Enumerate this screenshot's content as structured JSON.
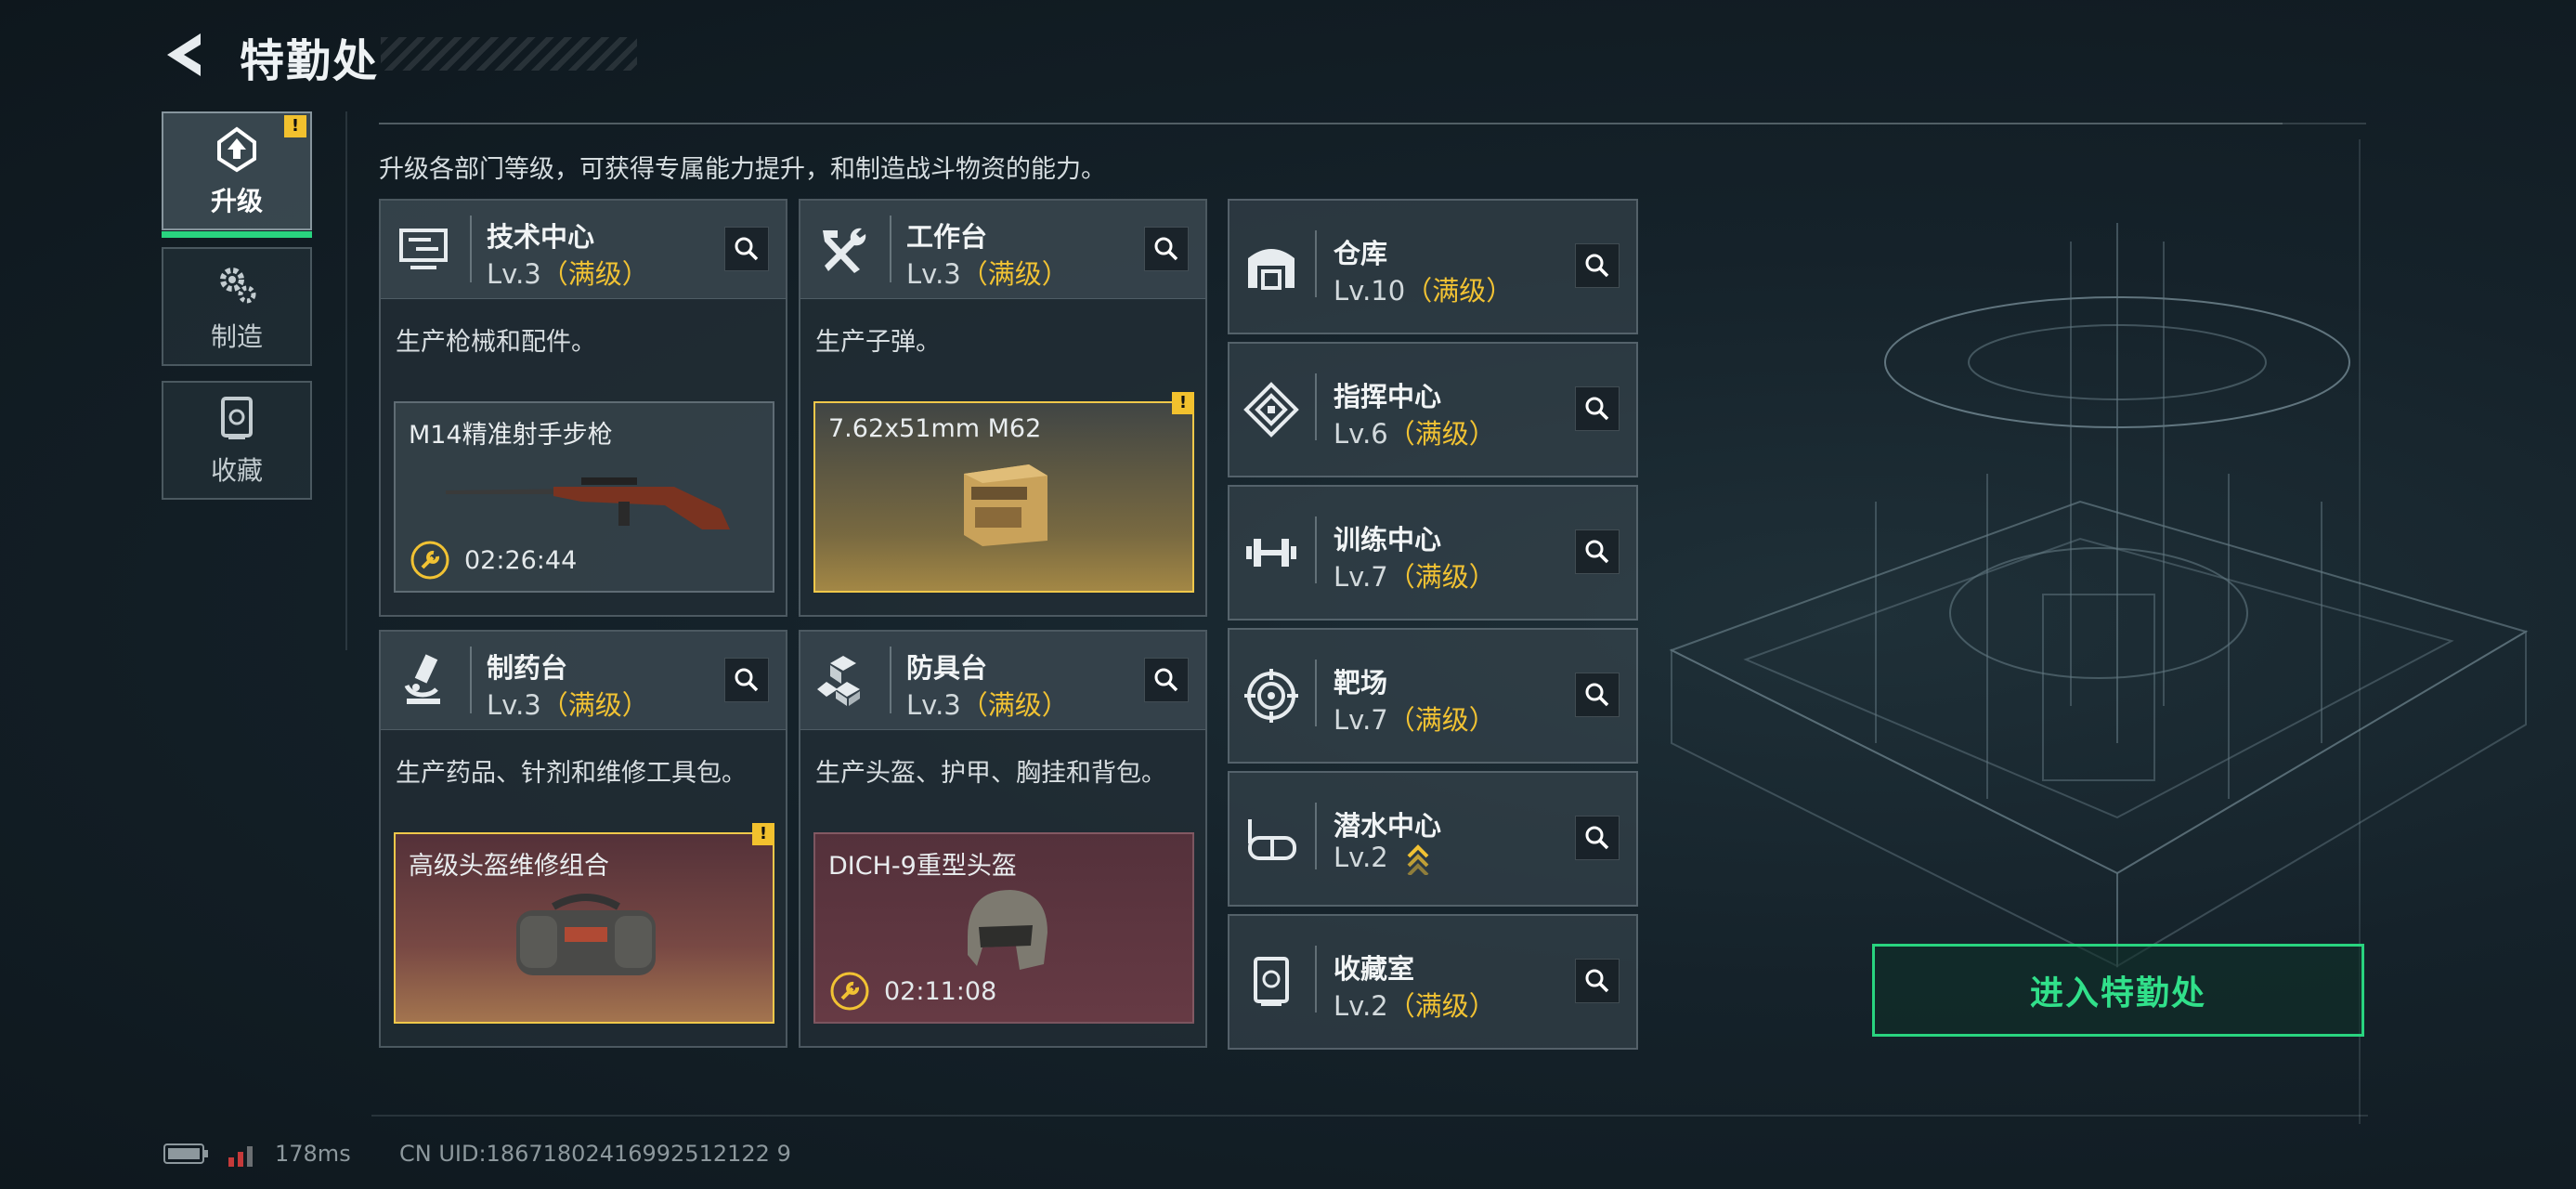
{
  "header": {
    "title": "特勤处"
  },
  "intro": "升级各部门等级，可获得专属能力提升，和制造战斗物资的能力。",
  "tabs": [
    {
      "label": "升级",
      "active": true,
      "badge": "!"
    },
    {
      "label": "制造",
      "active": false
    },
    {
      "label": "收藏",
      "active": false
    }
  ],
  "cards": [
    {
      "name": "技术中心",
      "level": "Lv.3",
      "max_label": "（满级）",
      "description": "生产枪械和配件。",
      "item": {
        "name": "M14精准射手步枪",
        "timer": "02:26:44"
      }
    },
    {
      "name": "工作台",
      "level": "Lv.3",
      "max_label": "（满级）",
      "description": "生产子弹。",
      "item": {
        "name": "7.62x51mm M62",
        "badge": "!"
      }
    },
    {
      "name": "制药台",
      "level": "Lv.3",
      "max_label": "（满级）",
      "description": "生产药品、针剂和维修工具包。",
      "item": {
        "name": "高级头盔维修组合",
        "badge": "!"
      }
    },
    {
      "name": "防具台",
      "level": "Lv.3",
      "max_label": "（满级）",
      "description": "生产头盔、护甲、胸挂和背包。",
      "item": {
        "name": "DICH-9重型头盔",
        "timer": "02:11:08"
      }
    }
  ],
  "facilities": [
    {
      "name": "仓库",
      "level": "Lv.10",
      "max_label": "（满级）",
      "icon": "warehouse-icon"
    },
    {
      "name": "指挥中心",
      "level": "Lv.6",
      "max_label": "（满级）",
      "icon": "command-icon"
    },
    {
      "name": "训练中心",
      "level": "Lv.7",
      "max_label": "（满级）",
      "icon": "dumbbell-icon"
    },
    {
      "name": "靶场",
      "level": "Lv.7",
      "max_label": "（满级）",
      "icon": "target-icon"
    },
    {
      "name": "潜水中心",
      "level": "Lv.2",
      "max_label": "",
      "icon": "diving-mask-icon",
      "upgrade_available": true
    },
    {
      "name": "收藏室",
      "level": "Lv.2",
      "max_label": "（满级）",
      "icon": "collection-icon"
    }
  ],
  "enter_button": "进入特勤处",
  "status": {
    "ping": "178ms",
    "uid": "CN UID:18671802416992512122 9"
  },
  "colors": {
    "accent_green": "#29d47f",
    "max_level_gold": "#f1c233",
    "warning_yellow": "#f2c12e"
  }
}
